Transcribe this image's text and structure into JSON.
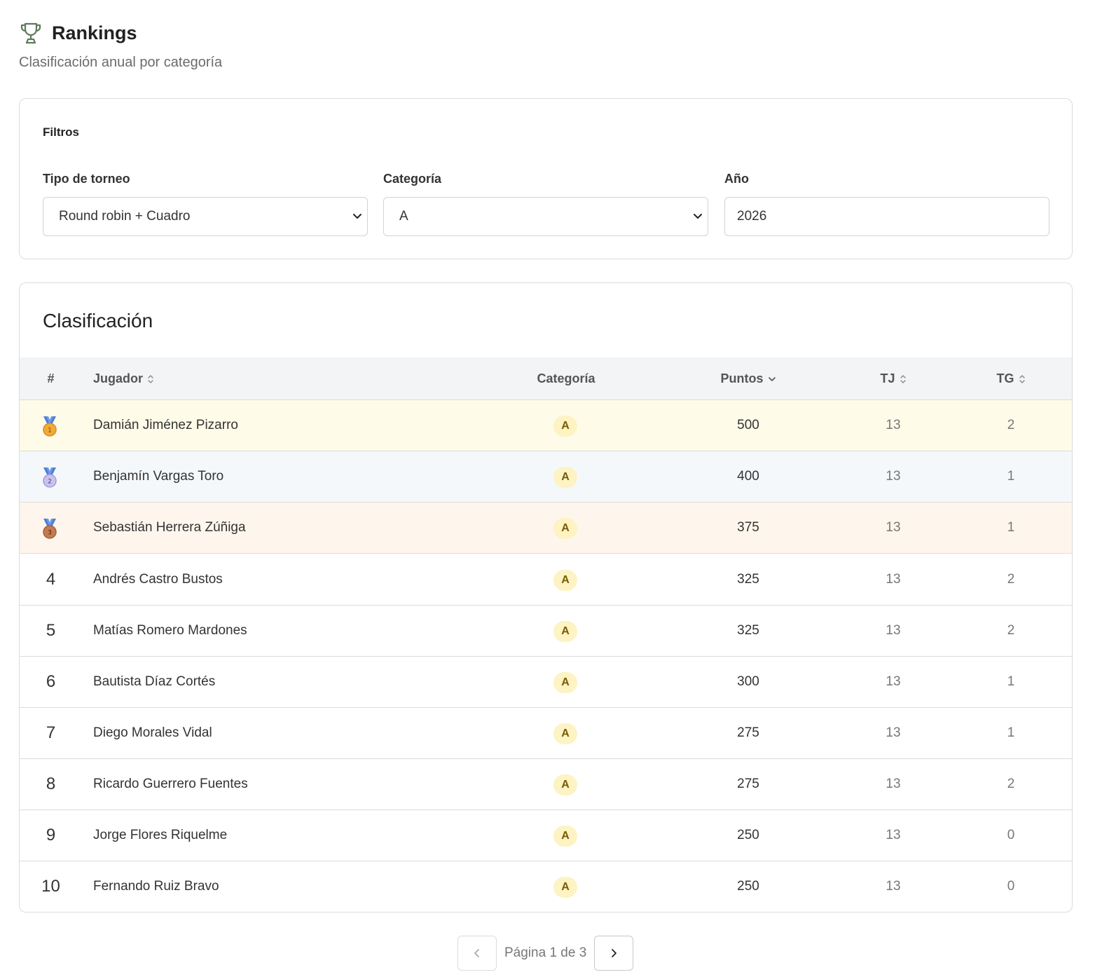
{
  "page": {
    "title": "Rankings",
    "subtitle": "Clasificación anual por categoría"
  },
  "filters": {
    "title": "Filtros",
    "tournament_type": {
      "label": "Tipo de torneo",
      "value": "Round robin + Cuadro"
    },
    "category": {
      "label": "Categoría",
      "value": "A"
    },
    "year": {
      "label": "Año",
      "value": "2026"
    }
  },
  "table": {
    "title": "Clasificación",
    "columns": {
      "rank": "#",
      "player": "Jugador",
      "category": "Categoría",
      "points": "Puntos",
      "tj": "TJ",
      "tg": "TG"
    },
    "rows": [
      {
        "rank": "1",
        "medal": "gold-medal-icon",
        "player": "Damián Jiménez Pizarro",
        "category": "A",
        "points": "500",
        "tj": "13",
        "tg": "2"
      },
      {
        "rank": "2",
        "medal": "silver-medal-icon",
        "player": "Benjamín Vargas Toro",
        "category": "A",
        "points": "400",
        "tj": "13",
        "tg": "1"
      },
      {
        "rank": "3",
        "medal": "bronze-medal-icon",
        "player": "Sebastián Herrera Zúñiga",
        "category": "A",
        "points": "375",
        "tj": "13",
        "tg": "1"
      },
      {
        "rank": "4",
        "player": "Andrés Castro Bustos",
        "category": "A",
        "points": "325",
        "tj": "13",
        "tg": "2"
      },
      {
        "rank": "5",
        "player": "Matías Romero Mardones",
        "category": "A",
        "points": "325",
        "tj": "13",
        "tg": "2"
      },
      {
        "rank": "6",
        "player": "Bautista Díaz Cortés",
        "category": "A",
        "points": "300",
        "tj": "13",
        "tg": "1"
      },
      {
        "rank": "7",
        "player": "Diego Morales Vidal",
        "category": "A",
        "points": "275",
        "tj": "13",
        "tg": "1"
      },
      {
        "rank": "8",
        "player": "Ricardo Guerrero Fuentes",
        "category": "A",
        "points": "275",
        "tj": "13",
        "tg": "2"
      },
      {
        "rank": "9",
        "player": "Jorge Flores Riquelme",
        "category": "A",
        "points": "250",
        "tj": "13",
        "tg": "0"
      },
      {
        "rank": "10",
        "player": "Fernando Ruiz Bravo",
        "category": "A",
        "points": "250",
        "tj": "13",
        "tg": "0"
      }
    ]
  },
  "pagination": {
    "text": "Página 1 de 3"
  },
  "colors": {
    "gold_row": "#fefbe8",
    "silver_row": "#f5f8fb",
    "bronze_row": "#fef6ec",
    "badge_bg": "#fdf3c3",
    "trophy": "#5c7a5c"
  }
}
